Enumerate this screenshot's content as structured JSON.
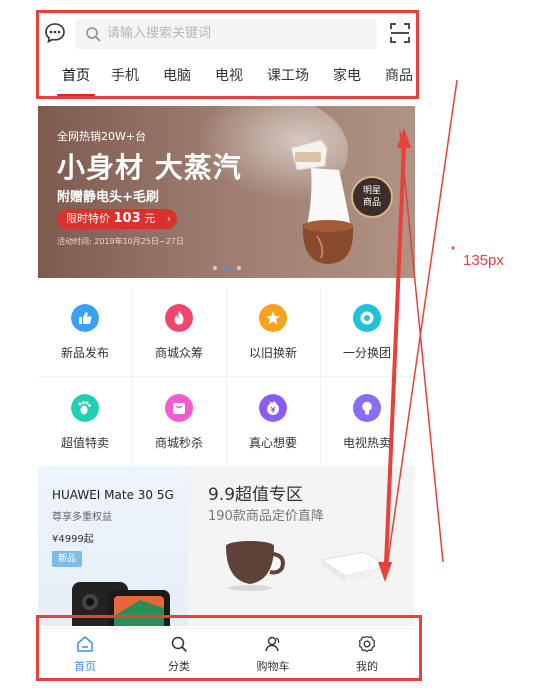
{
  "header": {
    "search_placeholder": "请输入搜索关键词",
    "icons": {
      "message": "chat-bubble-icon",
      "search": "search-icon",
      "scan": "scan-icon"
    }
  },
  "tabs": [
    {
      "label": "首页",
      "active": true
    },
    {
      "label": "手机",
      "active": false
    },
    {
      "label": "电脑",
      "active": false
    },
    {
      "label": "电视",
      "active": false
    },
    {
      "label": "课工场",
      "active": false
    },
    {
      "label": "家电",
      "active": false
    },
    {
      "label": "商品",
      "active": false
    }
  ],
  "banner": {
    "line1": "全网热销20W+台",
    "headline": "小身材 大蒸汽",
    "line3": "附赠静电头+毛刷",
    "pill_prefix": "限时特价",
    "pill_price": "103",
    "pill_suffix": "元",
    "pill_arrow": "›",
    "date_text": "活动时间: 2019年10月25日~27日",
    "badge_line1": "明星",
    "badge_line2": "商品",
    "slide_count": 3,
    "active_slide": 2
  },
  "grid_items": [
    {
      "label": "新品发布",
      "icon": "thumbs-up-icon",
      "color": "#3aa0f5"
    },
    {
      "label": "商城众筹",
      "icon": "flame-icon",
      "color": "#f0456d"
    },
    {
      "label": "以旧换新",
      "icon": "star-icon",
      "color": "#f7a21b"
    },
    {
      "label": "一分换团",
      "icon": "target-icon",
      "color": "#1ec3d8"
    },
    {
      "label": "超值特卖",
      "icon": "footprint-icon",
      "color": "#1fd1b0"
    },
    {
      "label": "商城秒杀",
      "icon": "shopping-bag-icon",
      "color": "#f25bd2"
    },
    {
      "label": "真心想要",
      "icon": "coin-icon",
      "color": "#8a5cf5"
    },
    {
      "label": "电视热卖",
      "icon": "lightbulb-icon",
      "color": "#8a6cf8"
    }
  ],
  "promo_left": {
    "title": "HUAWEI Mate 30 5G",
    "subtitle": "尊享多重权益",
    "price": "¥4999起",
    "tag": "新品"
  },
  "promo_right": {
    "title": "9.9超值专区",
    "subtitle": "190款商品定价直降"
  },
  "bottom_nav": [
    {
      "label": "首页",
      "icon": "home-icon",
      "active": true
    },
    {
      "label": "分类",
      "icon": "search-icon",
      "active": false
    },
    {
      "label": "购物车",
      "icon": "user-icon",
      "active": false
    },
    {
      "label": "我的",
      "icon": "settings-icon",
      "active": false
    }
  ],
  "annotation": {
    "label": "135px",
    "color": "#e8403b"
  }
}
